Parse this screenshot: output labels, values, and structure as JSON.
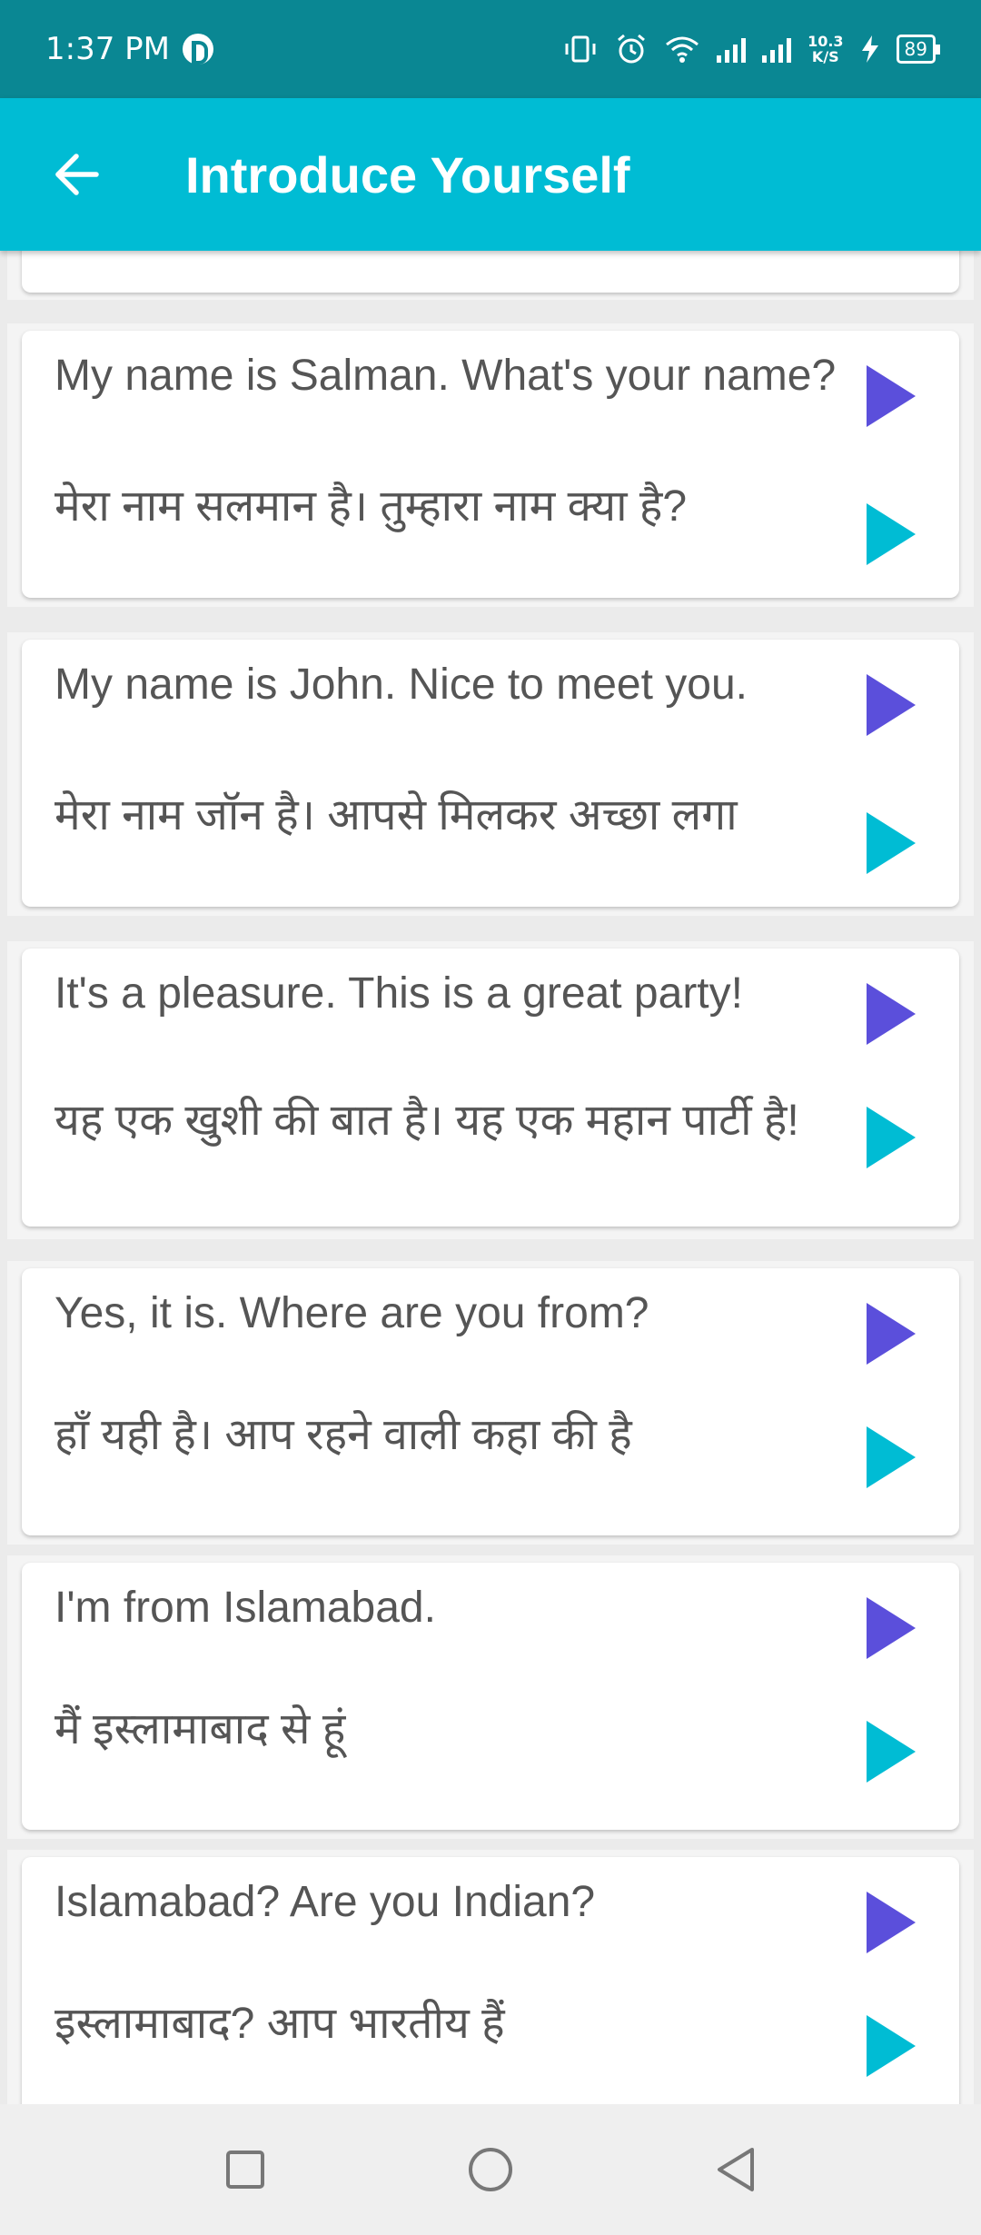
{
  "status_bar": {
    "time": "1:37 PM",
    "net_speed_value": "10.3",
    "net_speed_unit": "K/S",
    "battery": "89"
  },
  "app_bar": {
    "title": "Introduce Yourself",
    "back_icon": "arrow-left-icon"
  },
  "colors": {
    "status_bar": "#0a8793",
    "app_bar": "#00bcd4",
    "play_english": "#5b4fdb",
    "play_hindi": "#00bcd4",
    "text": "#555555"
  },
  "phrases": [
    {
      "english": "My name is Salman. What's your name?",
      "hindi": "मेरा नाम सलमान है। तुम्हारा नाम क्या है?"
    },
    {
      "english": "My name is John. Nice to meet you.",
      "hindi": "मेरा नाम जॉन है। आपसे मिलकर अच्छा लगा"
    },
    {
      "english": "It's a pleasure. This is a great party!",
      "hindi": "यह एक खुशी की बात है। यह एक महान पार्टी है!"
    },
    {
      "english": "Yes, it is. Where are you from?",
      "hindi": "हाँ यही है। आप रहने वाली कहा की है"
    },
    {
      "english": "I'm from Islamabad.",
      "hindi": "मैं इस्लामाबाद से हूं"
    },
    {
      "english": "Islamabad? Are you Indian?",
      "hindi": "इस्लामाबाद? आप भारतीय हैं"
    }
  ],
  "nav_bar": [
    "recents-square-icon",
    "home-circle-icon",
    "back-triangle-icon"
  ]
}
